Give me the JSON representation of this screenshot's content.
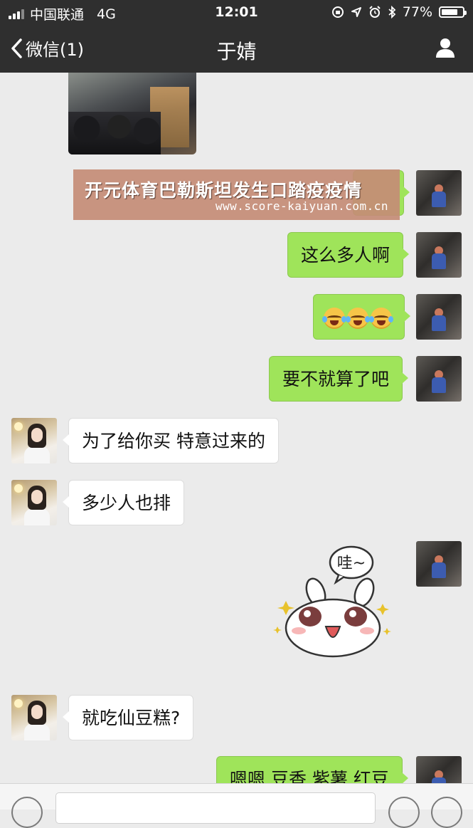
{
  "status_bar": {
    "carrier": "中国联通",
    "network": "4G",
    "time": "12:01",
    "battery": "77%",
    "battery_level": 0.77
  },
  "nav": {
    "back_label": "微信(1)",
    "title": "于婧",
    "profile_icon": "person-icon"
  },
  "messages": [
    {
      "side": "theirs",
      "type": "image"
    },
    {
      "side": "mine",
      "type": "text",
      "text": ""
    },
    {
      "side": "mine",
      "type": "text",
      "text": "这么多人啊"
    },
    {
      "side": "mine",
      "type": "emoji",
      "emoji": "crying-laughing-face",
      "count": 3
    },
    {
      "side": "mine",
      "type": "text",
      "text": "要不就算了吧"
    },
    {
      "side": "theirs",
      "type": "text",
      "text": "为了给你买 特意过来的"
    },
    {
      "side": "theirs",
      "type": "text",
      "text": "多少人也排"
    },
    {
      "side": "mine",
      "type": "sticker",
      "caption": "哇~"
    },
    {
      "side": "theirs",
      "type": "text",
      "text": "就吃仙豆糕?"
    },
    {
      "side": "mine",
      "type": "text",
      "text": "嗯嗯 豆香 紫薯 红豆"
    }
  ],
  "watermark": {
    "title": "开元体育巴勒斯坦发生口踏疫疫情",
    "url": "www.score-kaiyuan.com.cn"
  },
  "colors": {
    "nav_bg": "#2f2f2f",
    "mine_bubble": "#9fe45a",
    "theirs_bubble": "#ffffff",
    "chat_bg": "#ebebeb"
  }
}
